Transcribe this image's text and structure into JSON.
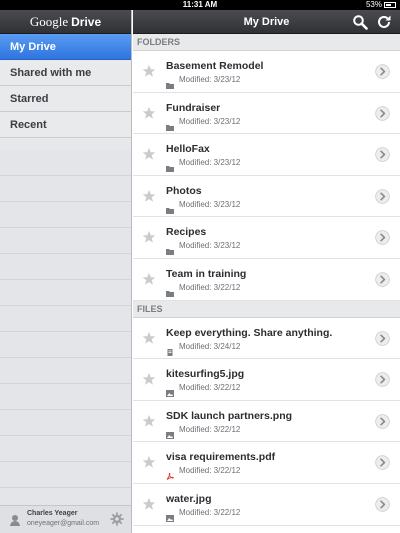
{
  "status_bar": {
    "time": "11:31 AM",
    "battery": "53%"
  },
  "sidebar": {
    "brand_a": "Google",
    "brand_b": "Drive",
    "items": [
      {
        "label": "My Drive",
        "active": true
      },
      {
        "label": "Shared with me",
        "active": false
      },
      {
        "label": "Starred",
        "active": false
      },
      {
        "label": "Recent",
        "active": false
      }
    ],
    "account": {
      "name": "Charles Yeager",
      "email": "oneyeager@gmail.com"
    }
  },
  "main": {
    "title": "My Drive",
    "folders_header": "FOLDERS",
    "files_header": "FILES",
    "folders": [
      {
        "name": "Basement Remodel",
        "modified": "Modified: 3/23/12"
      },
      {
        "name": "Fundraiser",
        "modified": "Modified: 3/23/12"
      },
      {
        "name": "HelloFax",
        "modified": "Modified: 3/23/12"
      },
      {
        "name": "Photos",
        "modified": "Modified: 3/23/12"
      },
      {
        "name": "Recipes",
        "modified": "Modified: 3/23/12"
      },
      {
        "name": "Team in training",
        "modified": "Modified: 3/22/12"
      }
    ],
    "files": [
      {
        "name": "Keep everything. Share anything.",
        "modified": "Modified: 3/24/12",
        "icon": "document-icon"
      },
      {
        "name": "kitesurfing5.jpg",
        "modified": "Modified: 3/22/12",
        "icon": "image-icon"
      },
      {
        "name": "SDK launch partners.png",
        "modified": "Modified: 3/22/12",
        "icon": "image-icon"
      },
      {
        "name": "visa requirements.pdf",
        "modified": "Modified: 3/22/12",
        "icon": "pdf-icon"
      },
      {
        "name": "water.jpg",
        "modified": "Modified: 3/22/12",
        "icon": "image-icon"
      }
    ]
  }
}
